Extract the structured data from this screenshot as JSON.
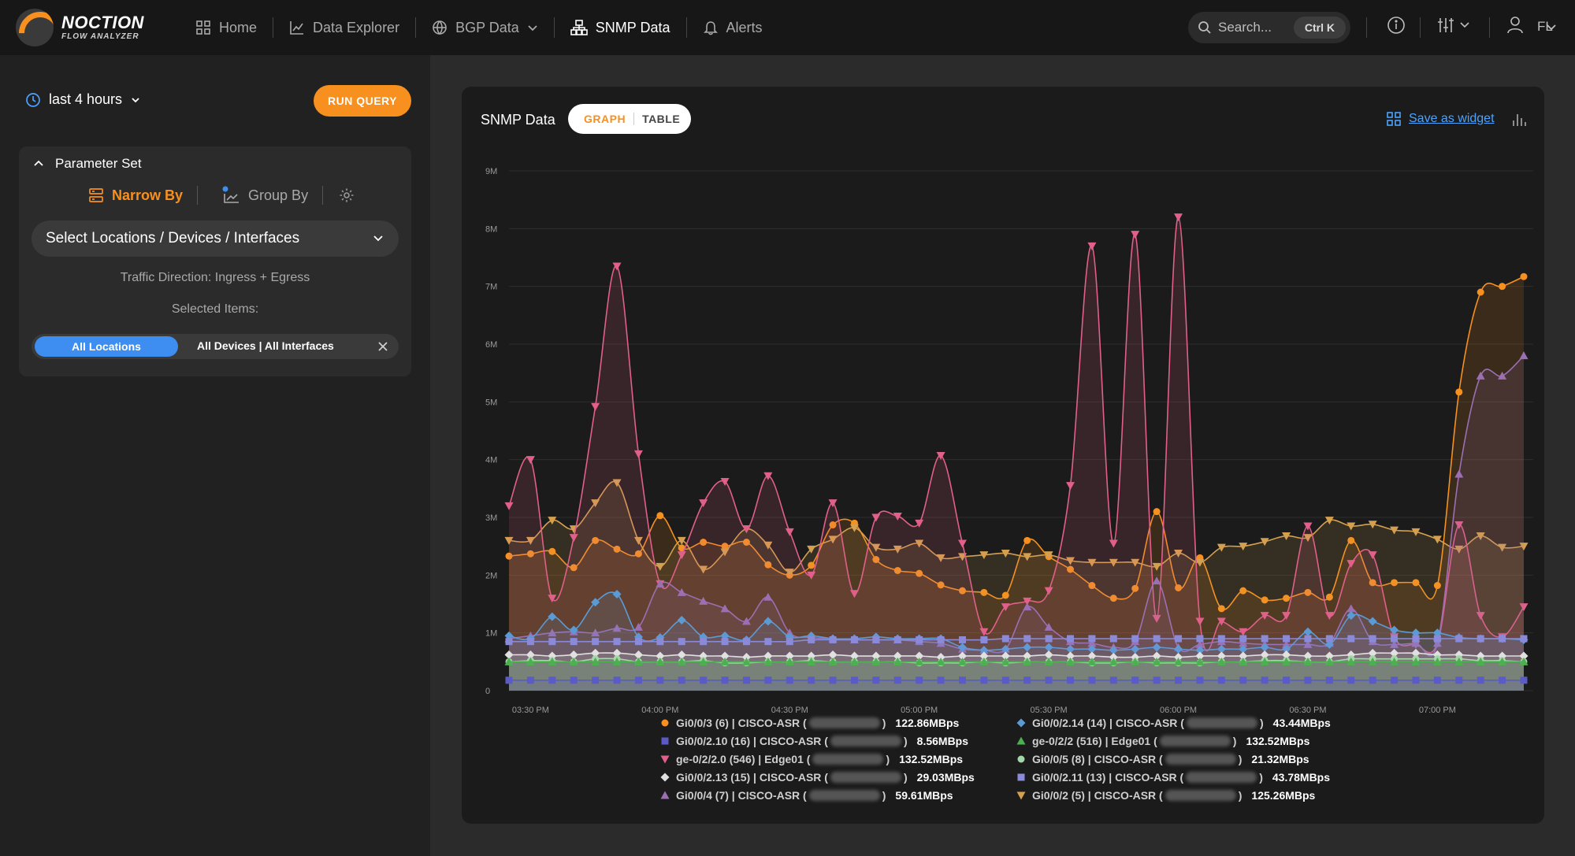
{
  "brand": {
    "title": "NOCTION",
    "subtitle": "FLOW ANALYZER"
  },
  "nav": [
    {
      "label": "Home",
      "icon": "grid-icon"
    },
    {
      "label": "Data Explorer",
      "icon": "chart-line-icon"
    },
    {
      "label": "BGP Data",
      "icon": "globe-icon"
    },
    {
      "label": "SNMP Data",
      "icon": "network-icon"
    },
    {
      "label": "Alerts",
      "icon": "bell-icon"
    }
  ],
  "search": {
    "placeholder": "Search...",
    "shortcut": "Ctrl K"
  },
  "user": {
    "initials": "FL"
  },
  "sidebar": {
    "time_range": "last 4 hours",
    "run_query": "RUN QUERY",
    "param_set": "Parameter Set",
    "narrow_by": "Narrow By",
    "group_by": "Group By",
    "select_placeholder": "Select Locations / Devices / Interfaces",
    "traffic_direction": "Traffic Direction: Ingress + Egress",
    "selected_items": "Selected Items:",
    "chip_locations": "All Locations",
    "chip_rest": "All Devices | All Interfaces"
  },
  "card": {
    "title": "SNMP Data",
    "tab_graph": "GRAPH",
    "tab_table": "TABLE",
    "save_widget": "Save as widget"
  },
  "colors": {
    "accent": "#f7901e",
    "link": "#4ba3ff",
    "chip": "#3d8ef0"
  },
  "chart_data": {
    "type": "area",
    "yticks": [
      "0",
      "1M",
      "2M",
      "3M",
      "4M",
      "5M",
      "6M",
      "7M",
      "8M",
      "9M"
    ],
    "ylim": [
      0,
      9000000
    ],
    "xticks": [
      "03:30 PM",
      "04:00 PM",
      "04:30 PM",
      "05:00 PM",
      "05:30 PM",
      "06:00 PM",
      "06:30 PM",
      "07:00 PM"
    ],
    "grid": true,
    "x_start": "03:30 PM",
    "x_interval_minutes": 5,
    "series": [
      {
        "name": "Gi0/0/3 (6) | CISCO-ASR (",
        "value_label": "122.86MBps",
        "color": "#f7901e",
        "marker": "circle",
        "values": [
          2.33,
          2.37,
          2.41,
          2.13,
          2.6,
          2.45,
          2.37,
          3.03,
          2.47,
          2.57,
          2.5,
          2.57,
          2.18,
          2.0,
          2.17,
          2.87,
          2.9,
          2.27,
          2.08,
          2.03,
          1.83,
          1.73,
          1.7,
          1.65,
          2.6,
          2.32,
          2.1,
          1.82,
          1.6,
          1.77,
          3.1,
          1.78,
          2.3,
          1.42,
          1.73,
          1.57,
          1.6,
          1.7,
          1.62,
          2.6,
          1.87,
          1.87,
          1.87,
          1.82,
          5.17,
          6.9,
          7.0,
          7.17
        ]
      },
      {
        "name": "Gi0/0/2.14 (14) | CISCO-ASR (",
        "value_label": "43.44MBps",
        "color": "#5b9bd5",
        "marker": "diamond",
        "values": [
          0.95,
          0.9,
          1.28,
          1.05,
          1.53,
          1.67,
          0.93,
          0.92,
          1.22,
          0.93,
          0.95,
          0.88,
          1.2,
          0.93,
          0.95,
          0.9,
          0.9,
          0.93,
          0.9,
          0.9,
          0.9,
          0.75,
          0.7,
          0.72,
          0.75,
          0.75,
          0.72,
          0.72,
          0.7,
          0.72,
          0.75,
          0.72,
          0.7,
          0.72,
          0.72,
          0.75,
          0.72,
          1.02,
          0.8,
          1.3,
          1.2,
          1.05,
          1.0,
          1.0,
          0.92,
          0.9,
          0.9,
          0.88
        ]
      },
      {
        "name": "Gi0/0/2.10 (16) | CISCO-ASR (",
        "value_label": "8.56MBps",
        "color": "#5b5bc8",
        "marker": "square",
        "values": [
          0.18,
          0.18,
          0.18,
          0.18,
          0.18,
          0.18,
          0.18,
          0.18,
          0.18,
          0.18,
          0.18,
          0.18,
          0.18,
          0.18,
          0.18,
          0.18,
          0.18,
          0.18,
          0.18,
          0.18,
          0.18,
          0.18,
          0.18,
          0.18,
          0.18,
          0.18,
          0.18,
          0.18,
          0.18,
          0.18,
          0.18,
          0.18,
          0.18,
          0.18,
          0.18,
          0.18,
          0.18,
          0.18,
          0.18,
          0.18,
          0.18,
          0.18,
          0.18,
          0.18,
          0.18,
          0.18,
          0.18,
          0.18
        ]
      },
      {
        "name": "ge-0/2/2 (516) | Edge01 (",
        "value_label": "132.52MBps",
        "color": "#4caf50",
        "marker": "triangle-up",
        "values": [
          0.5,
          0.5,
          0.5,
          0.5,
          0.5,
          0.5,
          0.5,
          0.5,
          0.5,
          0.5,
          0.5,
          0.5,
          0.5,
          0.5,
          0.5,
          0.5,
          0.5,
          0.5,
          0.5,
          0.5,
          0.5,
          0.5,
          0.5,
          0.5,
          0.5,
          0.5,
          0.5,
          0.5,
          0.5,
          0.5,
          0.5,
          0.5,
          0.5,
          0.5,
          0.5,
          0.5,
          0.5,
          0.5,
          0.5,
          0.5,
          0.5,
          0.5,
          0.5,
          0.5,
          0.5,
          0.5,
          0.5,
          0.5
        ]
      },
      {
        "name": "ge-0/2/2.0 (546) | Edge01 (",
        "value_label": "132.52MBps",
        "color": "#e0608a",
        "marker": "triangle-down",
        "values": [
          3.2,
          4.0,
          1.6,
          2.65,
          4.92,
          7.35,
          4.1,
          1.85,
          2.35,
          3.25,
          3.62,
          2.8,
          3.72,
          2.75,
          2.0,
          3.25,
          1.68,
          3.0,
          3.02,
          2.9,
          4.07,
          2.55,
          1.02,
          1.45,
          1.55,
          1.73,
          3.55,
          7.7,
          2.55,
          7.9,
          1.25,
          8.2,
          1.2,
          1.2,
          1.02,
          1.3,
          1.3,
          2.85,
          1.3,
          2.2,
          2.35,
          0.93,
          0.8,
          0.82,
          2.87,
          1.3,
          0.93,
          1.45
        ]
      },
      {
        "name": "Gi0/0/5 (8) | CISCO-ASR (",
        "value_label": "21.32MBps",
        "color": "#a5d6a7",
        "marker": "circle",
        "values": [
          0.5,
          0.52,
          0.52,
          0.5,
          0.55,
          0.55,
          0.5,
          0.5,
          0.5,
          0.52,
          0.48,
          0.48,
          0.5,
          0.5,
          0.52,
          0.5,
          0.5,
          0.5,
          0.5,
          0.48,
          0.48,
          0.48,
          0.5,
          0.48,
          0.5,
          0.5,
          0.5,
          0.48,
          0.48,
          0.5,
          0.48,
          0.48,
          0.48,
          0.5,
          0.5,
          0.52,
          0.52,
          0.5,
          0.5,
          0.55,
          0.55,
          0.55,
          0.55,
          0.55,
          0.55,
          0.52,
          0.52,
          0.5
        ]
      },
      {
        "name": "Gi0/0/2.13 (15) | CISCO-ASR (",
        "value_label": "29.03MBps",
        "color": "#e0e0e0",
        "marker": "diamond",
        "values": [
          0.62,
          0.62,
          0.6,
          0.62,
          0.65,
          0.65,
          0.62,
          0.6,
          0.62,
          0.6,
          0.6,
          0.58,
          0.6,
          0.6,
          0.6,
          0.62,
          0.6,
          0.6,
          0.6,
          0.6,
          0.58,
          0.6,
          0.6,
          0.6,
          0.6,
          0.62,
          0.6,
          0.6,
          0.58,
          0.58,
          0.6,
          0.58,
          0.6,
          0.6,
          0.6,
          0.62,
          0.62,
          0.6,
          0.6,
          0.62,
          0.65,
          0.65,
          0.65,
          0.62,
          0.62,
          0.6,
          0.6,
          0.6
        ]
      },
      {
        "name": "Gi0/0/2.11 (13) | CISCO-ASR (",
        "value_label": "43.78MBps",
        "color": "#8a8ad8",
        "marker": "square",
        "values": [
          0.85,
          0.85,
          0.85,
          0.85,
          0.85,
          0.85,
          0.85,
          0.85,
          0.85,
          0.85,
          0.85,
          0.85,
          0.85,
          0.85,
          0.88,
          0.88,
          0.88,
          0.88,
          0.88,
          0.88,
          0.88,
          0.88,
          0.88,
          0.9,
          0.9,
          0.9,
          0.9,
          0.9,
          0.9,
          0.9,
          0.9,
          0.9,
          0.9,
          0.9,
          0.9,
          0.9,
          0.9,
          0.9,
          0.9,
          0.9,
          0.9,
          0.9,
          0.9,
          0.9,
          0.9,
          0.9,
          0.9,
          0.9
        ]
      },
      {
        "name": "Gi0/0/4 (7) | CISCO-ASR (",
        "value_label": "59.61MBps",
        "color": "#9c6fb3",
        "marker": "triangle-up",
        "values": [
          0.9,
          0.95,
          1.0,
          1.02,
          1.0,
          1.08,
          1.1,
          1.85,
          1.7,
          1.55,
          1.42,
          1.2,
          1.62,
          1.0,
          0.92,
          0.9,
          0.88,
          0.88,
          0.88,
          0.85,
          0.82,
          0.72,
          0.7,
          0.72,
          1.45,
          1.1,
          0.85,
          0.82,
          0.75,
          0.85,
          1.9,
          0.75,
          0.8,
          0.85,
          0.82,
          0.8,
          0.8,
          0.8,
          0.82,
          1.42,
          0.85,
          0.8,
          0.82,
          0.82,
          3.75,
          5.45,
          5.45,
          5.8
        ]
      },
      {
        "name": "Gi0/0/2 (5) | CISCO-ASR (",
        "value_label": "125.26MBps",
        "color": "#d4a050",
        "marker": "triangle-down",
        "values": [
          2.6,
          2.6,
          2.95,
          2.8,
          3.25,
          3.6,
          2.6,
          2.15,
          2.6,
          2.1,
          2.4,
          2.8,
          2.52,
          2.05,
          2.45,
          2.62,
          2.82,
          2.48,
          2.45,
          2.55,
          2.3,
          2.32,
          2.35,
          2.38,
          2.32,
          2.35,
          2.25,
          2.22,
          2.22,
          2.22,
          2.15,
          2.38,
          2.22,
          2.48,
          2.5,
          2.58,
          2.68,
          2.65,
          2.95,
          2.85,
          2.88,
          2.78,
          2.75,
          2.62,
          2.45,
          2.68,
          2.48,
          2.5
        ]
      }
    ]
  }
}
